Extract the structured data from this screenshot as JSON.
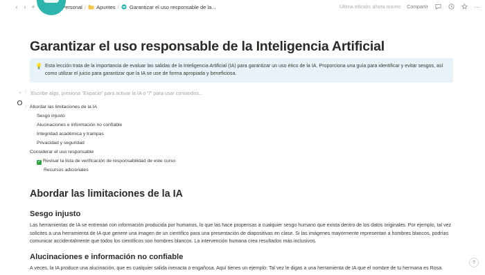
{
  "breadcrumb": {
    "items": [
      {
        "icon": "globe-icon",
        "label": "Wiki Personal"
      },
      {
        "icon": "folder-icon",
        "label": "Apuntes"
      },
      {
        "icon": "page-icon",
        "label": "Garantizar el uso responsable de la..."
      }
    ]
  },
  "topbar": {
    "edited_label": "Última edición: ahora mismo",
    "share_label": "Compartir"
  },
  "page": {
    "title": "Garantizar el uso responsable de la Inteligencia Artificial",
    "callout_icon": "lightbulb-icon",
    "callout_text": "Esta lección trata de la importancia de evaluar las salidas de la Inteligencia Artificial (IA) para garantizar un uso ético de la IA. Proporciona una guía para identificar y evitar sesgos, así como utilizar el juicio para garantizar que la IA se use de forma apropiada y beneficiosa.",
    "placeholder": "Escribe algo, presiona \"Espacio\" para activar la IA o \"/\" para usar comandos..."
  },
  "toc": [
    {
      "label": "Abordar las limitaciones de la IA",
      "level": 0,
      "checked": false
    },
    {
      "label": "Sesgo injusto",
      "level": 1,
      "checked": false
    },
    {
      "label": "Alucinaciones e información no confiable",
      "level": 1,
      "checked": false
    },
    {
      "label": "Integridad académica y trampas",
      "level": 1,
      "checked": false
    },
    {
      "label": "Privacidad y seguridad",
      "level": 1,
      "checked": false
    },
    {
      "label": "Considerar el uso responsable",
      "level": 0,
      "checked": false
    },
    {
      "label": "Revisar la lista de verificación de responsabilidad de este curso",
      "level": 1,
      "checked": true
    },
    {
      "label": "Recursos adicionales",
      "level": 2,
      "checked": false
    }
  ],
  "sections": {
    "h1": "Abordar las limitaciones de la IA",
    "h2_bias": "Sesgo injusto",
    "bias_text": "Las herramientas de IA se entrenan con información producida por humanos, lo que las hace propensas a cualquier sesgo humano que exista dentro de los datos originales. Por ejemplo, tal vez solicites a una herramienta de IA que genere una imagen de un científico para una presentación de diapositivas en clase. Si las imágenes mayormente representan a hombres blancos, podrías comunicar accidentalmente que todos los científicos son hombres blancos. La intervención humana crea resultados más inclusivos.",
    "h2_halluc": "Alucinaciones e información no confiable",
    "halluc_text": "A veces, la IA produce una alucinación, que es cualquier salida inexacta o engañosa. Aquí tienes un ejemplo: Tal vez le digas a una herramienta de IA que el nombre de tu hermana es Rosa."
  },
  "help_label": "?"
}
